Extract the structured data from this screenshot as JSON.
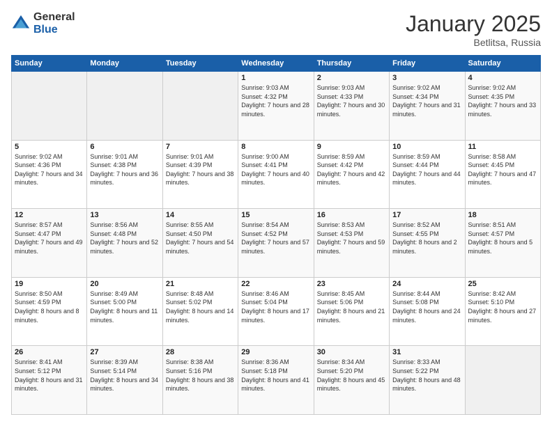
{
  "header": {
    "logo_general": "General",
    "logo_blue": "Blue",
    "month_title": "January 2025",
    "location": "Betlitsa, Russia"
  },
  "days_of_week": [
    "Sunday",
    "Monday",
    "Tuesday",
    "Wednesday",
    "Thursday",
    "Friday",
    "Saturday"
  ],
  "weeks": [
    [
      {
        "day": "",
        "sunrise": "",
        "sunset": "",
        "daylight": ""
      },
      {
        "day": "",
        "sunrise": "",
        "sunset": "",
        "daylight": ""
      },
      {
        "day": "",
        "sunrise": "",
        "sunset": "",
        "daylight": ""
      },
      {
        "day": "1",
        "sunrise": "Sunrise: 9:03 AM",
        "sunset": "Sunset: 4:32 PM",
        "daylight": "Daylight: 7 hours and 28 minutes."
      },
      {
        "day": "2",
        "sunrise": "Sunrise: 9:03 AM",
        "sunset": "Sunset: 4:33 PM",
        "daylight": "Daylight: 7 hours and 30 minutes."
      },
      {
        "day": "3",
        "sunrise": "Sunrise: 9:02 AM",
        "sunset": "Sunset: 4:34 PM",
        "daylight": "Daylight: 7 hours and 31 minutes."
      },
      {
        "day": "4",
        "sunrise": "Sunrise: 9:02 AM",
        "sunset": "Sunset: 4:35 PM",
        "daylight": "Daylight: 7 hours and 33 minutes."
      }
    ],
    [
      {
        "day": "5",
        "sunrise": "Sunrise: 9:02 AM",
        "sunset": "Sunset: 4:36 PM",
        "daylight": "Daylight: 7 hours and 34 minutes."
      },
      {
        "day": "6",
        "sunrise": "Sunrise: 9:01 AM",
        "sunset": "Sunset: 4:38 PM",
        "daylight": "Daylight: 7 hours and 36 minutes."
      },
      {
        "day": "7",
        "sunrise": "Sunrise: 9:01 AM",
        "sunset": "Sunset: 4:39 PM",
        "daylight": "Daylight: 7 hours and 38 minutes."
      },
      {
        "day": "8",
        "sunrise": "Sunrise: 9:00 AM",
        "sunset": "Sunset: 4:41 PM",
        "daylight": "Daylight: 7 hours and 40 minutes."
      },
      {
        "day": "9",
        "sunrise": "Sunrise: 8:59 AM",
        "sunset": "Sunset: 4:42 PM",
        "daylight": "Daylight: 7 hours and 42 minutes."
      },
      {
        "day": "10",
        "sunrise": "Sunrise: 8:59 AM",
        "sunset": "Sunset: 4:44 PM",
        "daylight": "Daylight: 7 hours and 44 minutes."
      },
      {
        "day": "11",
        "sunrise": "Sunrise: 8:58 AM",
        "sunset": "Sunset: 4:45 PM",
        "daylight": "Daylight: 7 hours and 47 minutes."
      }
    ],
    [
      {
        "day": "12",
        "sunrise": "Sunrise: 8:57 AM",
        "sunset": "Sunset: 4:47 PM",
        "daylight": "Daylight: 7 hours and 49 minutes."
      },
      {
        "day": "13",
        "sunrise": "Sunrise: 8:56 AM",
        "sunset": "Sunset: 4:48 PM",
        "daylight": "Daylight: 7 hours and 52 minutes."
      },
      {
        "day": "14",
        "sunrise": "Sunrise: 8:55 AM",
        "sunset": "Sunset: 4:50 PM",
        "daylight": "Daylight: 7 hours and 54 minutes."
      },
      {
        "day": "15",
        "sunrise": "Sunrise: 8:54 AM",
        "sunset": "Sunset: 4:52 PM",
        "daylight": "Daylight: 7 hours and 57 minutes."
      },
      {
        "day": "16",
        "sunrise": "Sunrise: 8:53 AM",
        "sunset": "Sunset: 4:53 PM",
        "daylight": "Daylight: 7 hours and 59 minutes."
      },
      {
        "day": "17",
        "sunrise": "Sunrise: 8:52 AM",
        "sunset": "Sunset: 4:55 PM",
        "daylight": "Daylight: 8 hours and 2 minutes."
      },
      {
        "day": "18",
        "sunrise": "Sunrise: 8:51 AM",
        "sunset": "Sunset: 4:57 PM",
        "daylight": "Daylight: 8 hours and 5 minutes."
      }
    ],
    [
      {
        "day": "19",
        "sunrise": "Sunrise: 8:50 AM",
        "sunset": "Sunset: 4:59 PM",
        "daylight": "Daylight: 8 hours and 8 minutes."
      },
      {
        "day": "20",
        "sunrise": "Sunrise: 8:49 AM",
        "sunset": "Sunset: 5:00 PM",
        "daylight": "Daylight: 8 hours and 11 minutes."
      },
      {
        "day": "21",
        "sunrise": "Sunrise: 8:48 AM",
        "sunset": "Sunset: 5:02 PM",
        "daylight": "Daylight: 8 hours and 14 minutes."
      },
      {
        "day": "22",
        "sunrise": "Sunrise: 8:46 AM",
        "sunset": "Sunset: 5:04 PM",
        "daylight": "Daylight: 8 hours and 17 minutes."
      },
      {
        "day": "23",
        "sunrise": "Sunrise: 8:45 AM",
        "sunset": "Sunset: 5:06 PM",
        "daylight": "Daylight: 8 hours and 21 minutes."
      },
      {
        "day": "24",
        "sunrise": "Sunrise: 8:44 AM",
        "sunset": "Sunset: 5:08 PM",
        "daylight": "Daylight: 8 hours and 24 minutes."
      },
      {
        "day": "25",
        "sunrise": "Sunrise: 8:42 AM",
        "sunset": "Sunset: 5:10 PM",
        "daylight": "Daylight: 8 hours and 27 minutes."
      }
    ],
    [
      {
        "day": "26",
        "sunrise": "Sunrise: 8:41 AM",
        "sunset": "Sunset: 5:12 PM",
        "daylight": "Daylight: 8 hours and 31 minutes."
      },
      {
        "day": "27",
        "sunrise": "Sunrise: 8:39 AM",
        "sunset": "Sunset: 5:14 PM",
        "daylight": "Daylight: 8 hours and 34 minutes."
      },
      {
        "day": "28",
        "sunrise": "Sunrise: 8:38 AM",
        "sunset": "Sunset: 5:16 PM",
        "daylight": "Daylight: 8 hours and 38 minutes."
      },
      {
        "day": "29",
        "sunrise": "Sunrise: 8:36 AM",
        "sunset": "Sunset: 5:18 PM",
        "daylight": "Daylight: 8 hours and 41 minutes."
      },
      {
        "day": "30",
        "sunrise": "Sunrise: 8:34 AM",
        "sunset": "Sunset: 5:20 PM",
        "daylight": "Daylight: 8 hours and 45 minutes."
      },
      {
        "day": "31",
        "sunrise": "Sunrise: 8:33 AM",
        "sunset": "Sunset: 5:22 PM",
        "daylight": "Daylight: 8 hours and 48 minutes."
      },
      {
        "day": "",
        "sunrise": "",
        "sunset": "",
        "daylight": ""
      }
    ]
  ]
}
